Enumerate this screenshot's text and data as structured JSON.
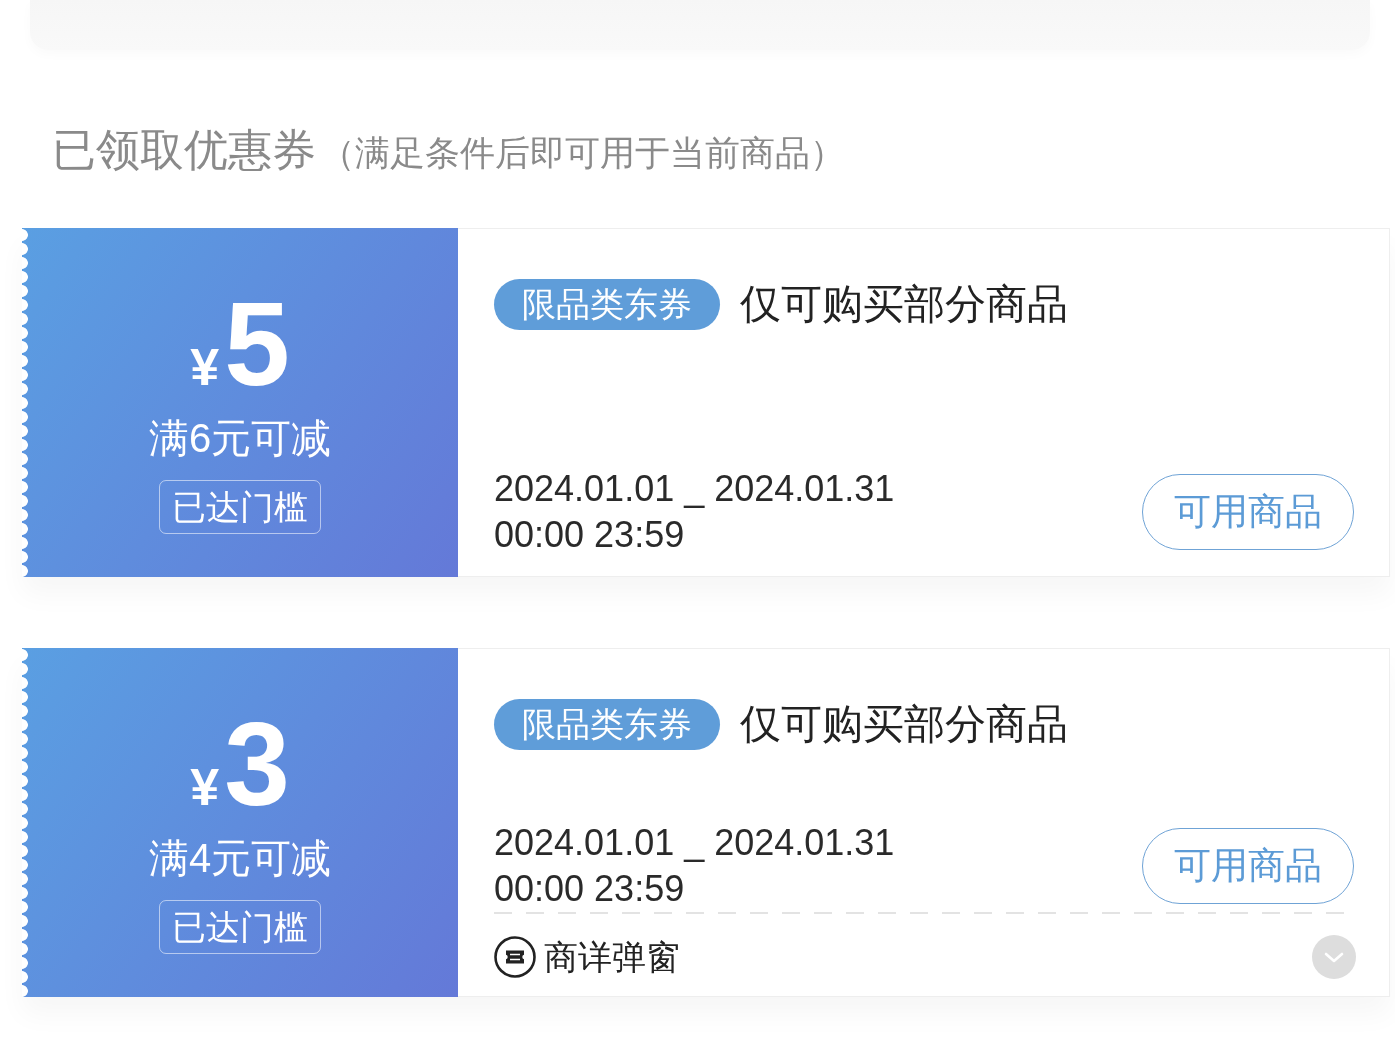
{
  "section": {
    "title": "已领取优惠券",
    "note": "（满足条件后即可用于当前商品）"
  },
  "coupons": [
    {
      "currency": "¥",
      "amount": "5",
      "condition": "满6元可减",
      "status_badge": "已达门槛",
      "tag": "限品类东券",
      "title": "仅可购买部分商品",
      "validity": [
        "2024.01.01 _ 2024.01.31",
        "00:00 23:59"
      ],
      "button": "可用商品"
    },
    {
      "currency": "¥",
      "amount": "3",
      "condition": "满4元可减",
      "status_badge": "已达门槛",
      "tag": "限品类东券",
      "title": "仅可购买部分商品",
      "validity": [
        "2024.01.01 _ 2024.01.31",
        "00:00 23:59"
      ],
      "button": "可用商品",
      "footer": {
        "label": "商详弹窗"
      }
    }
  ]
}
